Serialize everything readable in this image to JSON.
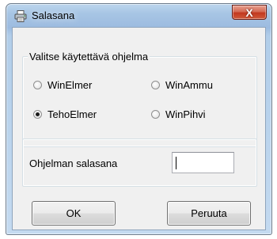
{
  "window": {
    "title": "Salasana",
    "icon": "printer-icon",
    "close_label": "X"
  },
  "program_group": {
    "legend": "Valitse käytettävä ohjelma",
    "options": [
      {
        "label": "WinElmer",
        "selected": false
      },
      {
        "label": "WinAmmu",
        "selected": false
      },
      {
        "label": "TehoElmer",
        "selected": true
      },
      {
        "label": "WinPihvi",
        "selected": false
      }
    ]
  },
  "password": {
    "label": "Ohjelman salasana",
    "value": ""
  },
  "buttons": {
    "ok": "OK",
    "cancel": "Peruuta"
  }
}
